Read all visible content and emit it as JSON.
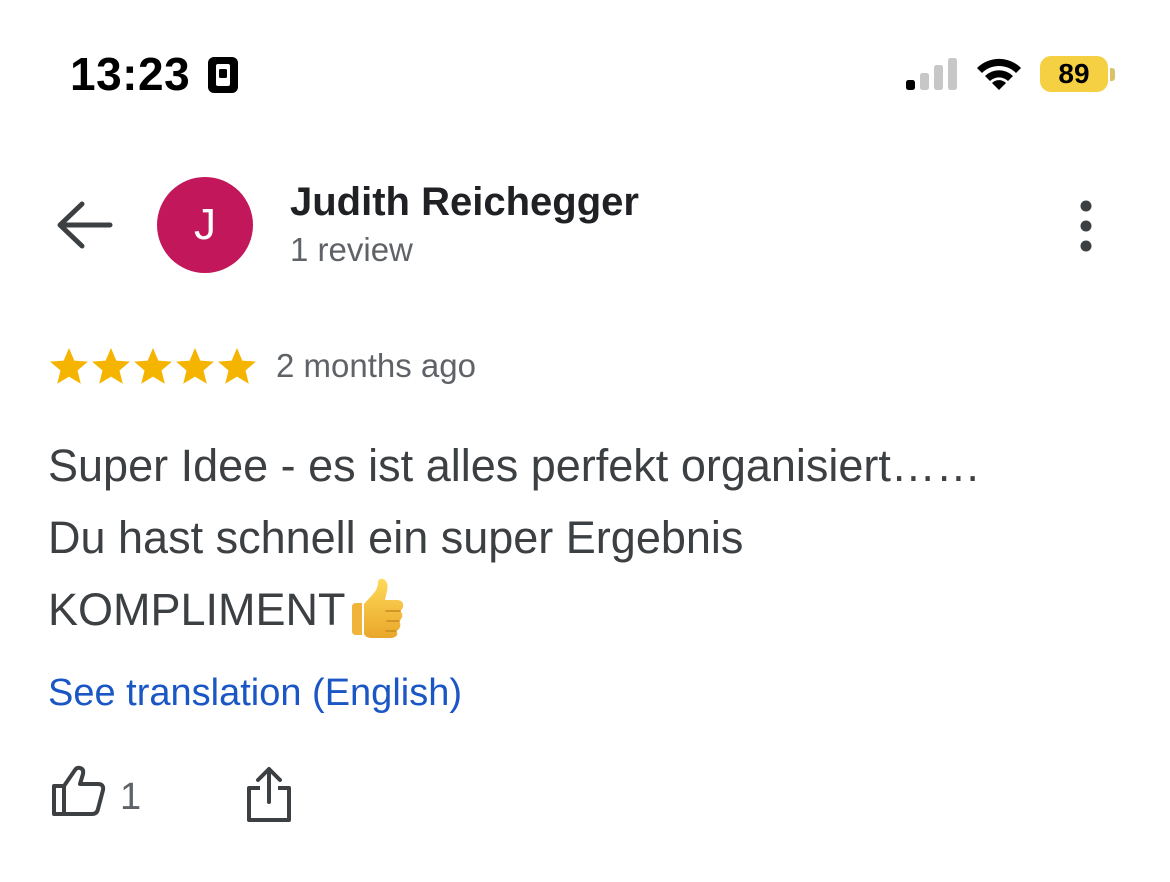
{
  "status_bar": {
    "time": "13:23",
    "battery_level": "89",
    "signal_bars_active": 1,
    "signal_bars_total": 4,
    "icons": [
      "lock-icon",
      "cellular-signal-icon",
      "wifi-icon",
      "battery-icon"
    ]
  },
  "header": {
    "back_icon": "arrow-left-icon",
    "avatar_initial": "J",
    "avatar_color": "#c2185b",
    "reviewer_name": "Judith Reichegger",
    "review_count": "1 review",
    "more_icon": "more-vert-icon"
  },
  "review": {
    "rating": 5,
    "max_rating": 5,
    "star_color": "#f4b400",
    "time_ago": "2 months ago",
    "text_lines": [
      "Super Idee - es ist alles perfekt organisiert……",
      "Du hast schnell ein super Ergebnis",
      "KOMPLIMENT"
    ],
    "trailing_emoji": "thumbs-up-emoji",
    "translation_link": "See translation (English)",
    "link_color": "#1a56c4"
  },
  "actions": {
    "like_icon": "thumb-up-outline-icon",
    "like_count": "1",
    "share_icon": "share-icon"
  }
}
